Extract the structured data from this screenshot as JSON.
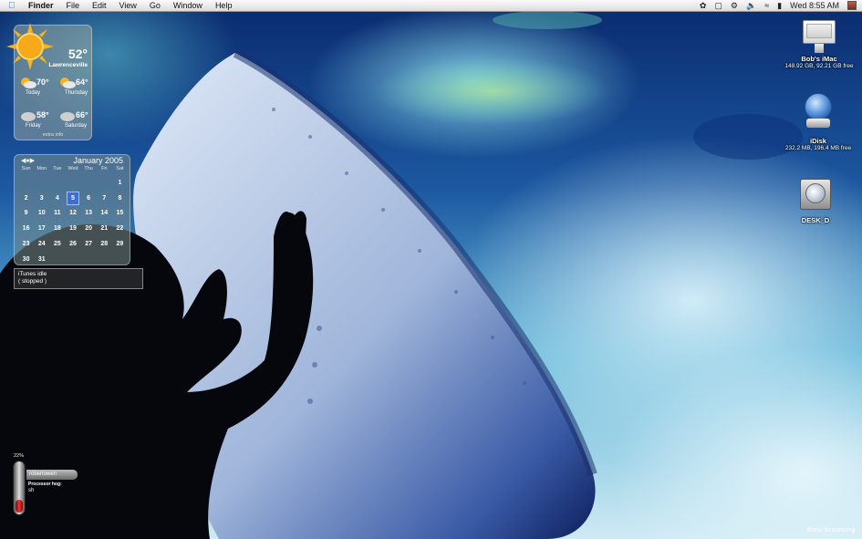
{
  "menubar": {
    "app_name": "Finder",
    "items": [
      "File",
      "Edit",
      "View",
      "Go",
      "Window",
      "Help"
    ],
    "clock": "Wed 8:55 AM"
  },
  "weather": {
    "current_temp": "52°",
    "city": "Lawrenceville",
    "forecast": [
      {
        "day": "Today",
        "temp": "70°",
        "icon": "sun-cloud-icon"
      },
      {
        "day": "Thursday",
        "temp": "64°",
        "icon": "sun-cloud-icon"
      },
      {
        "day": "Friday",
        "temp": "58°",
        "icon": "cloud-icon"
      },
      {
        "day": "Saturday",
        "temp": "66°",
        "icon": "cloud-icon"
      }
    ],
    "extra": "extra info"
  },
  "calendar": {
    "title": "January 2005",
    "weekdays": [
      "Sun",
      "Mon",
      "Tue",
      "Wed",
      "Thu",
      "Fri",
      "Sat"
    ],
    "cells": [
      "",
      "",
      "",
      "",
      "",
      "",
      "1",
      "2",
      "3",
      "4",
      "5",
      "6",
      "7",
      "8",
      "9",
      "10",
      "11",
      "12",
      "13",
      "14",
      "15",
      "16",
      "17",
      "18",
      "19",
      "20",
      "21",
      "22",
      "23",
      "24",
      "25",
      "26",
      "27",
      "28",
      "29",
      "30",
      "31",
      "",
      "",
      "",
      "",
      ""
    ],
    "today": "5"
  },
  "itunes": {
    "line1": "iTunes idle",
    "line2": "( stopped )"
  },
  "processor": {
    "percent_text": "22%",
    "load_fraction": 0.22,
    "user": "robertowen",
    "label": "Processor hog:",
    "process": "sh"
  },
  "desktop_icons": [
    {
      "name": "Bob's iMac",
      "info": "148.92 GB, 92.21 GB free",
      "icon": "imac-icon"
    },
    {
      "name": "iDisk",
      "info": "232.2 MB, 196.4 MB free",
      "icon": "idisk-icon"
    },
    {
      "name": "DESK_D",
      "info": "",
      "icon": "hard-drive-icon"
    }
  ],
  "footer_text": "Web-browsing",
  "colors": {
    "calendar_today": "#3a6fd6",
    "cpu_fill": "#e33333"
  }
}
